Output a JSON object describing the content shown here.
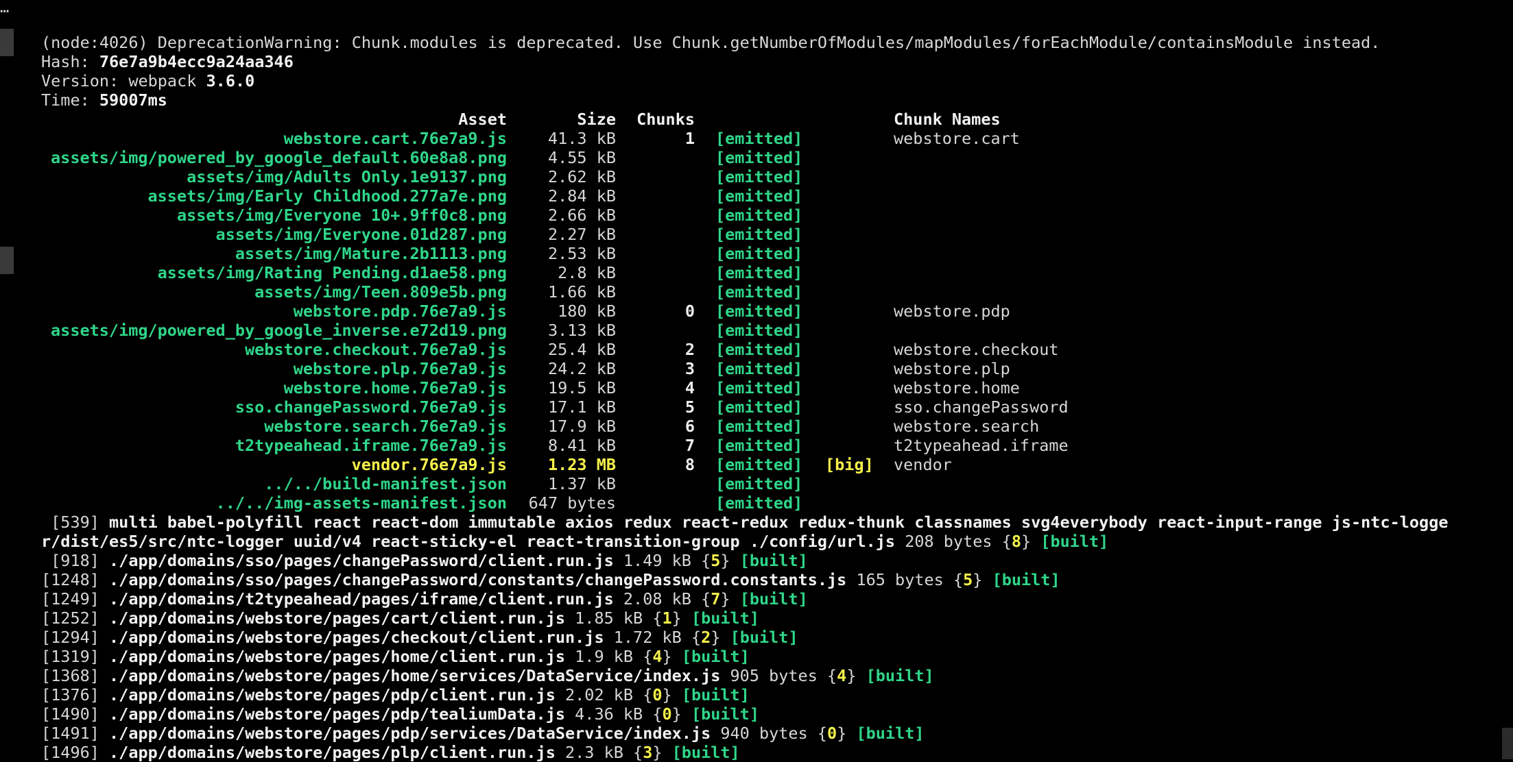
{
  "header_lines": {
    "deprecation": "(node:4026) DeprecationWarning: Chunk.modules is deprecated. Use Chunk.getNumberOfModules/mapModules/forEachModule/containsModule instead.",
    "hash_label": "Hash: ",
    "hash_value": "76e7a9b4ecc9a24aa346",
    "version_label": "Version: webpack ",
    "version_value": "3.6.0",
    "time_label": "Time: ",
    "time_value": "59007ms"
  },
  "asset_table": {
    "headers": {
      "asset": "Asset",
      "size": "Size",
      "chunks": "Chunks",
      "chunk_names": "Chunk Names"
    },
    "rows": [
      {
        "asset": "webstore.cart.76e7a9.js",
        "size": "41.3 kB",
        "chunks": "1",
        "status": "[emitted]",
        "big": "",
        "name": "webstore.cart",
        "color": "g"
      },
      {
        "asset": "assets/img/powered_by_google_default.60e8a8.png",
        "size": "4.55 kB",
        "chunks": "",
        "status": "[emitted]",
        "big": "",
        "name": "",
        "color": "g"
      },
      {
        "asset": "assets/img/Adults Only.1e9137.png",
        "size": "2.62 kB",
        "chunks": "",
        "status": "[emitted]",
        "big": "",
        "name": "",
        "color": "g"
      },
      {
        "asset": "assets/img/Early Childhood.277a7e.png",
        "size": "2.84 kB",
        "chunks": "",
        "status": "[emitted]",
        "big": "",
        "name": "",
        "color": "g"
      },
      {
        "asset": "assets/img/Everyone 10+.9ff0c8.png",
        "size": "2.66 kB",
        "chunks": "",
        "status": "[emitted]",
        "big": "",
        "name": "",
        "color": "g"
      },
      {
        "asset": "assets/img/Everyone.01d287.png",
        "size": "2.27 kB",
        "chunks": "",
        "status": "[emitted]",
        "big": "",
        "name": "",
        "color": "g"
      },
      {
        "asset": "assets/img/Mature.2b1113.png",
        "size": "2.53 kB",
        "chunks": "",
        "status": "[emitted]",
        "big": "",
        "name": "",
        "color": "g"
      },
      {
        "asset": "assets/img/Rating Pending.d1ae58.png",
        "size": "2.8 kB",
        "chunks": "",
        "status": "[emitted]",
        "big": "",
        "name": "",
        "color": "g"
      },
      {
        "asset": "assets/img/Teen.809e5b.png",
        "size": "1.66 kB",
        "chunks": "",
        "status": "[emitted]",
        "big": "",
        "name": "",
        "color": "g"
      },
      {
        "asset": "webstore.pdp.76e7a9.js",
        "size": "180 kB",
        "chunks": "0",
        "status": "[emitted]",
        "big": "",
        "name": "webstore.pdp",
        "color": "g"
      },
      {
        "asset": "assets/img/powered_by_google_inverse.e72d19.png",
        "size": "3.13 kB",
        "chunks": "",
        "status": "[emitted]",
        "big": "",
        "name": "",
        "color": "g"
      },
      {
        "asset": "webstore.checkout.76e7a9.js",
        "size": "25.4 kB",
        "chunks": "2",
        "status": "[emitted]",
        "big": "",
        "name": "webstore.checkout",
        "color": "g"
      },
      {
        "asset": "webstore.plp.76e7a9.js",
        "size": "24.2 kB",
        "chunks": "3",
        "status": "[emitted]",
        "big": "",
        "name": "webstore.plp",
        "color": "g"
      },
      {
        "asset": "webstore.home.76e7a9.js",
        "size": "19.5 kB",
        "chunks": "4",
        "status": "[emitted]",
        "big": "",
        "name": "webstore.home",
        "color": "g"
      },
      {
        "asset": "sso.changePassword.76e7a9.js",
        "size": "17.1 kB",
        "chunks": "5",
        "status": "[emitted]",
        "big": "",
        "name": "sso.changePassword",
        "color": "g"
      },
      {
        "asset": "webstore.search.76e7a9.js",
        "size": "17.9 kB",
        "chunks": "6",
        "status": "[emitted]",
        "big": "",
        "name": "webstore.search",
        "color": "g"
      },
      {
        "asset": "t2typeahead.iframe.76e7a9.js",
        "size": "8.41 kB",
        "chunks": "7",
        "status": "[emitted]",
        "big": "",
        "name": "t2typeahead.iframe",
        "color": "g"
      },
      {
        "asset": "vendor.76e7a9.js",
        "size": "1.23 MB",
        "chunks": "8",
        "status": "[emitted]",
        "big": "[big]",
        "name": "vendor",
        "color": "y"
      },
      {
        "asset": "../../build-manifest.json",
        "size": "1.37 kB",
        "chunks": "",
        "status": "[emitted]",
        "big": "",
        "name": "",
        "color": "g"
      },
      {
        "asset": "../../img-assets-manifest.json",
        "size": "647 bytes",
        "chunks": "",
        "status": "[emitted]",
        "big": "",
        "name": "",
        "color": "g"
      }
    ]
  },
  "module_lines": [
    {
      "id": " [539]",
      "path": " multi babel-polyfill react react-dom immutable axios redux react-redux redux-thunk classnames svg4everybody react-input-range js-ntc-logge",
      "size": "",
      "chunk": "",
      "built": "",
      "bold_path": true
    },
    {
      "id": "",
      "path": "r/dist/es5/src/ntc-logger uuid/v4 react-sticky-el react-transition-group ./config/url.js",
      "size": " 208 bytes ",
      "chunk": "8",
      "built": "[built]",
      "bold_path": true
    },
    {
      "id": " [918]",
      "path": " ./app/domains/sso/pages/changePassword/client.run.js",
      "size": " 1.49 kB ",
      "chunk": "5",
      "built": "[built]",
      "bold_path": true
    },
    {
      "id": "[1248]",
      "path": " ./app/domains/sso/pages/changePassword/constants/changePassword.constants.js",
      "size": " 165 bytes ",
      "chunk": "5",
      "built": "[built]",
      "bold_path": true
    },
    {
      "id": "[1249]",
      "path": " ./app/domains/t2typeahead/pages/iframe/client.run.js",
      "size": " 2.08 kB ",
      "chunk": "7",
      "built": "[built]",
      "bold_path": true
    },
    {
      "id": "[1252]",
      "path": " ./app/domains/webstore/pages/cart/client.run.js",
      "size": " 1.85 kB ",
      "chunk": "1",
      "built": "[built]",
      "bold_path": true
    },
    {
      "id": "[1294]",
      "path": " ./app/domains/webstore/pages/checkout/client.run.js",
      "size": " 1.72 kB ",
      "chunk": "2",
      "built": "[built]",
      "bold_path": true
    },
    {
      "id": "[1319]",
      "path": " ./app/domains/webstore/pages/home/client.run.js",
      "size": " 1.9 kB ",
      "chunk": "4",
      "built": "[built]",
      "bold_path": true
    },
    {
      "id": "[1368]",
      "path": " ./app/domains/webstore/pages/home/services/DataService/index.js",
      "size": " 905 bytes ",
      "chunk": "4",
      "built": "[built]",
      "bold_path": true
    },
    {
      "id": "[1376]",
      "path": " ./app/domains/webstore/pages/pdp/client.run.js",
      "size": " 2.02 kB ",
      "chunk": "0",
      "built": "[built]",
      "bold_path": true
    },
    {
      "id": "[1490]",
      "path": " ./app/domains/webstore/pages/pdp/tealiumData.js",
      "size": " 4.36 kB ",
      "chunk": "0",
      "built": "[built]",
      "bold_path": true
    },
    {
      "id": "[1491]",
      "path": " ./app/domains/webstore/pages/pdp/services/DataService/index.js",
      "size": " 940 bytes ",
      "chunk": "0",
      "built": "[built]",
      "bold_path": true
    },
    {
      "id": "[1496]",
      "path": " ./app/domains/webstore/pages/plp/client.run.js",
      "size": " 2.3 kB ",
      "chunk": "3",
      "built": "[built]",
      "bold_path": true
    }
  ],
  "gutter": {
    "ellipsis": "…"
  },
  "colors": {
    "background": "#000000",
    "text": "#d7d7d7",
    "green": "#2fd689",
    "yellow": "#f7f24a"
  }
}
